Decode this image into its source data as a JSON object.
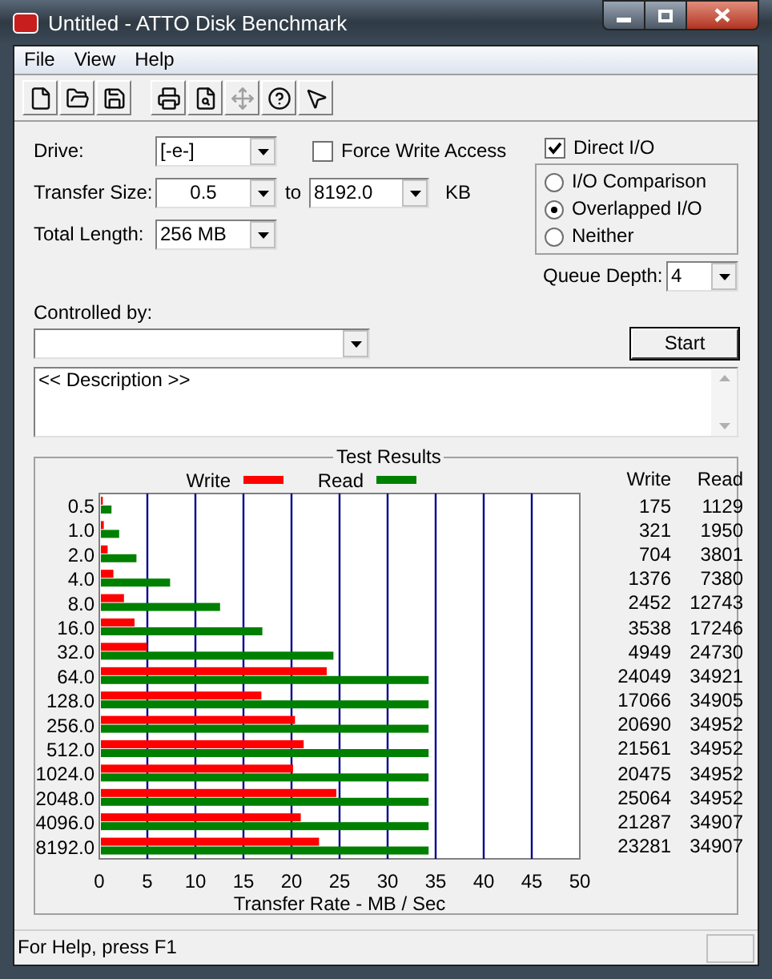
{
  "window": {
    "title": "Untitled - ATTO Disk Benchmark"
  },
  "menu": [
    {
      "label": "File"
    },
    {
      "label": "View"
    },
    {
      "label": "Help"
    }
  ],
  "toolbar": [
    {
      "kind": "new",
      "disabled": false
    },
    {
      "kind": "open",
      "disabled": false
    },
    {
      "kind": "save",
      "disabled": false
    },
    {
      "kind": "gap"
    },
    {
      "kind": "print",
      "disabled": false
    },
    {
      "kind": "preview",
      "disabled": false
    },
    {
      "kind": "move",
      "disabled": true
    },
    {
      "kind": "help",
      "disabled": false
    },
    {
      "kind": "context_help",
      "disabled": false
    }
  ],
  "drive": {
    "label": "Drive:",
    "value": "[-e-]"
  },
  "transfer_size": {
    "label": "Transfer Size:",
    "from": "0.5",
    "to_label": "to",
    "to": "8192.0",
    "unit": "KB"
  },
  "total_length": {
    "label": "Total Length:",
    "value": "256 MB"
  },
  "force_write_access": {
    "label": "Force Write Access",
    "checked": false
  },
  "direct_io": {
    "label": "Direct I/O",
    "checked": true
  },
  "io_modes": [
    {
      "label": "I/O Comparison",
      "selected": false
    },
    {
      "label": "Overlapped I/O",
      "selected": true
    },
    {
      "label": "Neither",
      "selected": false
    }
  ],
  "queue_depth": {
    "label": "Queue Depth:",
    "value": "4"
  },
  "controlled_by": {
    "label": "Controlled by:"
  },
  "start_button": "Start",
  "description": "<< Description >>",
  "test_results": {
    "title": "Test Results",
    "columns": [
      "Write",
      "Read"
    ],
    "rows": [
      {
        "write": "175",
        "read": "1129"
      },
      {
        "write": "321",
        "read": "1950"
      },
      {
        "write": "704",
        "read": "3801"
      },
      {
        "write": "1376",
        "read": "7380"
      },
      {
        "write": "2452",
        "read": "12743"
      },
      {
        "write": "3538",
        "read": "17246"
      },
      {
        "write": "4949",
        "read": "24730"
      },
      {
        "write": "24049",
        "read": "34921"
      },
      {
        "write": "17066",
        "read": "34905"
      },
      {
        "write": "20690",
        "read": "34952"
      },
      {
        "write": "21561",
        "read": "34952"
      },
      {
        "write": "20475",
        "read": "34952"
      },
      {
        "write": "25064",
        "read": "34952"
      },
      {
        "write": "21287",
        "read": "34907"
      },
      {
        "write": "23281",
        "read": "34907"
      }
    ],
    "chart_data": {
      "type": "bar",
      "orientation": "horizontal",
      "xlabel": "Transfer Rate - MB / Sec",
      "categories": [
        "0.5",
        "1.0",
        "2.0",
        "4.0",
        "8.0",
        "16.0",
        "32.0",
        "64.0",
        "128.0",
        "256.0",
        "512.0",
        "1024.0",
        "2048.0",
        "4096.0",
        "8192.0"
      ],
      "series": [
        {
          "name": "Write",
          "color": "#ff0000",
          "values": [
            0.2,
            0.3,
            0.7,
            1.3,
            2.4,
            3.5,
            4.8,
            23.5,
            16.7,
            20.2,
            21.1,
            20.0,
            24.5,
            20.8,
            22.7
          ]
        },
        {
          "name": "Read",
          "color": "#008000",
          "values": [
            1.1,
            1.9,
            3.7,
            7.2,
            12.4,
            16.8,
            24.2,
            34.1,
            34.1,
            34.1,
            34.1,
            34.1,
            34.1,
            34.1,
            34.1
          ]
        }
      ],
      "xlim": [
        0,
        50
      ],
      "xticks": [
        0,
        5,
        10,
        15,
        20,
        25,
        30,
        35,
        40,
        45,
        50
      ],
      "grid": true,
      "legend": "top"
    }
  },
  "status_bar": "For Help, press F1"
}
